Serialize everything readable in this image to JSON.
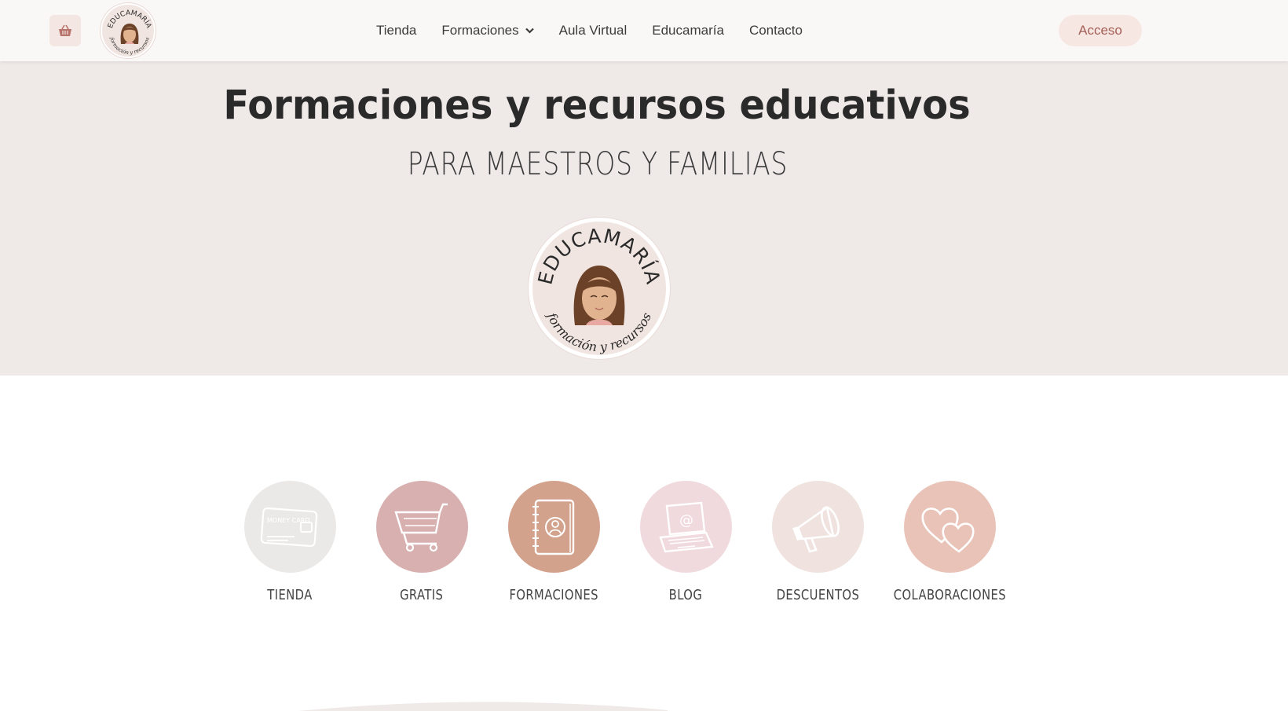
{
  "header": {
    "cart_icon": "basket-icon",
    "logo_text_top": "EDUCAMARÍA",
    "logo_text_bottom": "formación y recursos",
    "nav": [
      {
        "label": "Tienda"
      },
      {
        "label": "Formaciones",
        "has_dropdown": true
      },
      {
        "label": "Aula Virtual"
      },
      {
        "label": "Educamaría"
      },
      {
        "label": "Contacto"
      }
    ],
    "login_label": "Acceso"
  },
  "hero": {
    "title": "Formaciones y recursos educativos",
    "subtitle": "PARA MAESTROS Y FAMILIAS",
    "logo_text_top": "EDUCAMARÍA",
    "logo_text_bottom": "formación y recursos"
  },
  "categories": [
    {
      "label": "TIENDA",
      "icon": "money-card-icon",
      "icon_text": "MONEY CARD",
      "color": "#ebe9e8"
    },
    {
      "label": "GRATIS",
      "icon": "shopping-cart-icon",
      "color": "#d8b0b0"
    },
    {
      "label": "FORMACIONES",
      "icon": "notebook-icon",
      "color": "#d3a28d"
    },
    {
      "label": "BLOG",
      "icon": "laptop-icon",
      "color": "#f1dadd"
    },
    {
      "label": "DESCUENTOS",
      "icon": "megaphone-icon",
      "color": "#efe2df"
    },
    {
      "label": "COLABORACIONES",
      "icon": "hearts-icon",
      "color": "#e9c3b8"
    }
  ],
  "colors": {
    "header_bg": "#faf8f7",
    "hero_bg": "#efe9e8",
    "accent": "#a45f57",
    "accent_light": "#f7e7e3"
  }
}
